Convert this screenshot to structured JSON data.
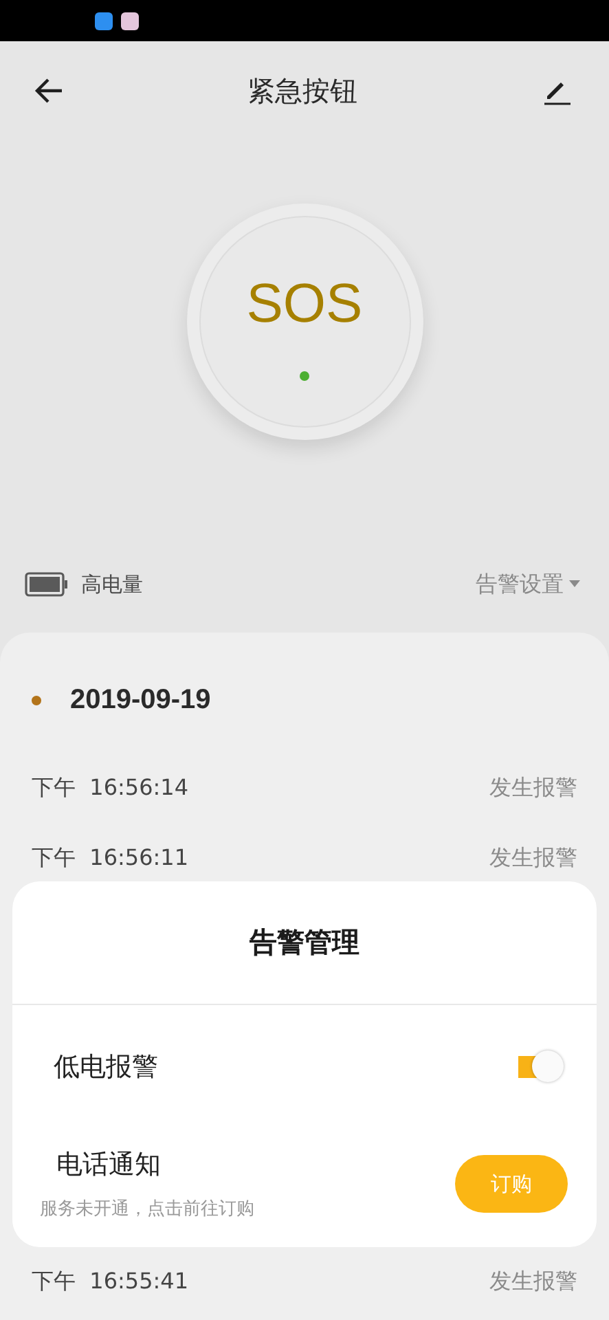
{
  "header": {
    "title": "紧急按钮"
  },
  "sos": {
    "label": "SOS"
  },
  "status_row": {
    "battery": "高电量",
    "settings": "告警设置"
  },
  "history": {
    "date": "2019-09-19",
    "records": [
      {
        "period": "下午",
        "time": "16:56:14",
        "event": "发生报警"
      },
      {
        "period": "下午",
        "time": "16:56:11",
        "event": "发生报警"
      },
      {
        "period": "下午",
        "time": "16:55:41",
        "event": "发生报警"
      }
    ]
  },
  "dialog": {
    "title": "告警管理",
    "items": [
      {
        "kind": "toggle",
        "label": "低电报警",
        "on": true
      },
      {
        "kind": "subscribe",
        "label": "电话通知",
        "hint": "服务未开通，点击前往订购",
        "button": "订购"
      }
    ]
  }
}
